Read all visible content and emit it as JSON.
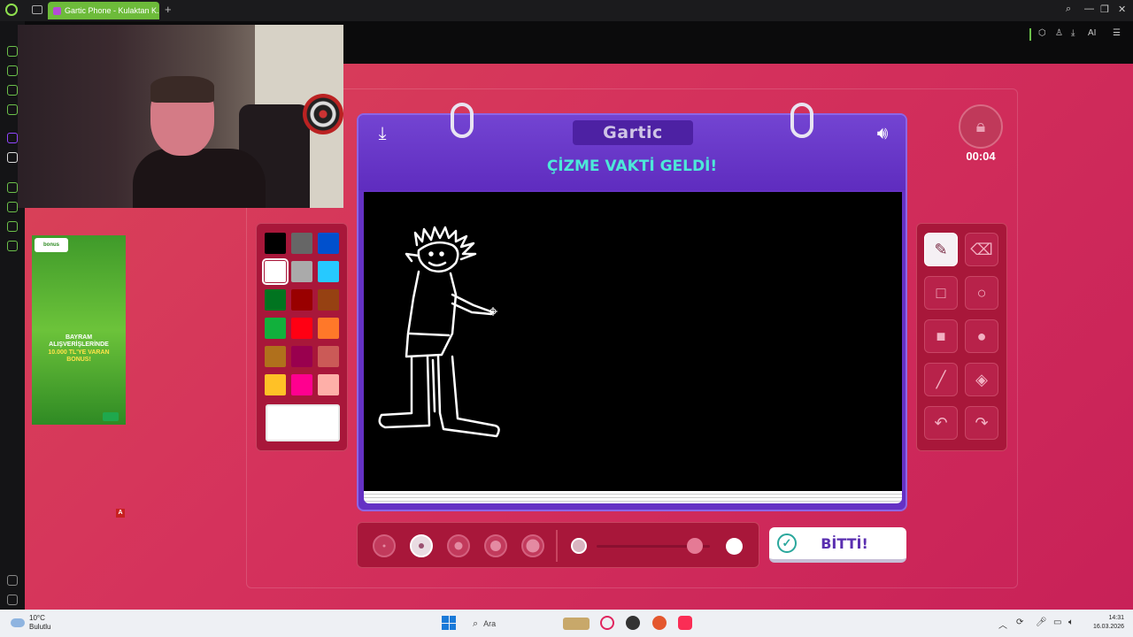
{
  "browser": {
    "tab_title": "Gartic Phone - Kulaktan K...",
    "new_tab": "+",
    "toolbar_ai": "AI"
  },
  "webcam": {
    "icon": "webcam-overlay"
  },
  "ad": {
    "logo_text": "bonus",
    "line1": "BAYRAM ALIŞVERİŞLERİNDE",
    "line2": "10.000 TL'YE VARAN",
    "line3": "BONUS!",
    "marker": "A"
  },
  "game": {
    "brand": "Gartic",
    "headline": "ÇİZME VAKTİ GELDİ!",
    "timer": "00:04",
    "done_label": "BİTTİ!",
    "icons": {
      "download": "download-icon",
      "sound": "speaker-icon",
      "lock": "lock-icon"
    }
  },
  "palette": {
    "colors": [
      "#000000",
      "#666666",
      "#0050cd",
      "#ffffff",
      "#aaaaaa",
      "#26c9ff",
      "#017420",
      "#990000",
      "#964112",
      "#11b03c",
      "#ff0013",
      "#ff7829",
      "#b0701c",
      "#99004e",
      "#cb5a57",
      "#ffc126",
      "#ff008f",
      "#feafa8"
    ],
    "selected_index": 3,
    "current_color": "#ffffff"
  },
  "tools": [
    {
      "name": "pencil",
      "active": true
    },
    {
      "name": "eraser",
      "active": false
    },
    {
      "name": "rectangle-outline",
      "active": false
    },
    {
      "name": "ellipse-outline",
      "active": false
    },
    {
      "name": "rectangle-filled",
      "active": false
    },
    {
      "name": "ellipse-filled",
      "active": false
    },
    {
      "name": "line",
      "active": false
    },
    {
      "name": "bucket-fill",
      "active": false
    },
    {
      "name": "undo",
      "active": false
    },
    {
      "name": "redo",
      "active": false
    }
  ],
  "brushes": {
    "count": 5,
    "selected_index": 1
  },
  "opacity": {
    "value": 0.87
  },
  "taskbar": {
    "temperature": "10°C",
    "weather": "Bulutlu",
    "search_placeholder": "Ara",
    "time": "14:31",
    "date": "16.03.2026"
  }
}
